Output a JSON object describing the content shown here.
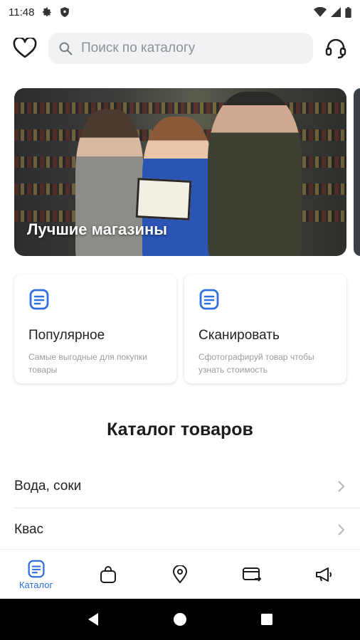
{
  "status_bar": {
    "time": "11:48"
  },
  "search": {
    "placeholder": "Поиск по каталогу"
  },
  "banner": {
    "title": "Лучшие магазины"
  },
  "cards": [
    {
      "title": "Популярное",
      "description": "Самые выгодные для покупки товары"
    },
    {
      "title": "Сканировать",
      "description": "Сфотографируй товар чтобы узнать стоимость"
    }
  ],
  "catalog": {
    "heading": "Каталог товаров",
    "items": [
      {
        "label": "Вода, соки"
      },
      {
        "label": "Квас"
      }
    ]
  },
  "bottom_nav": {
    "items": [
      {
        "label": "Каталог",
        "icon": "catalog-icon",
        "active": true
      },
      {
        "label": "",
        "icon": "bag-icon",
        "active": false
      },
      {
        "label": "",
        "icon": "location-pin-icon",
        "active": false
      },
      {
        "label": "",
        "icon": "card-transfer-icon",
        "active": false
      },
      {
        "label": "",
        "icon": "megaphone-icon",
        "active": false
      }
    ]
  },
  "colors": {
    "accent": "#2f6fe0",
    "muted_text": "#9a9ca0",
    "search_bg": "#f1f2f4"
  }
}
